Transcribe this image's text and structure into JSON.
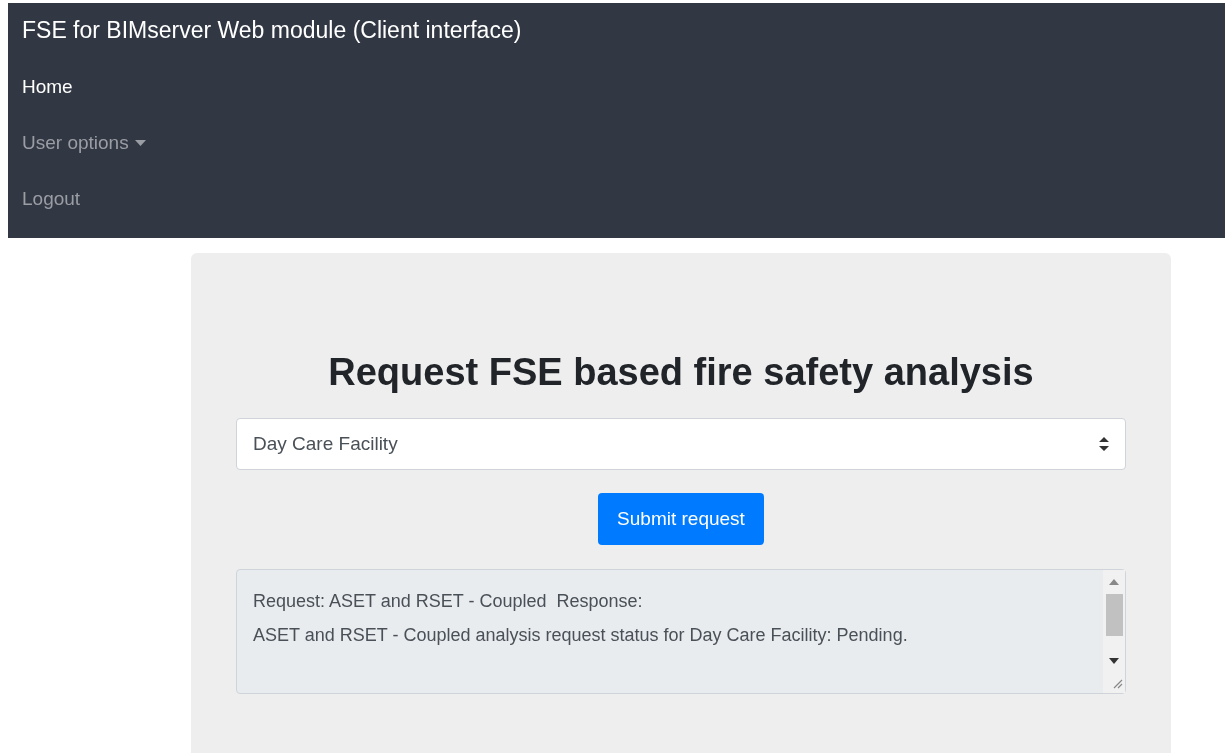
{
  "navbar": {
    "brand": "FSE for BIMserver Web module (Client interface)",
    "items": [
      {
        "label": "Home",
        "selected": true,
        "dropdown": false
      },
      {
        "label": "User options",
        "selected": false,
        "dropdown": true
      },
      {
        "label": "Logout",
        "selected": false,
        "dropdown": false
      }
    ]
  },
  "panel": {
    "heading": "Request FSE based fire safety analysis",
    "select": {
      "value": "Day Care Facility"
    },
    "submit_button": "Submit request",
    "response": {
      "lines": [
        "Request: ASET and RSET - Coupled  Response:",
        "ASET and RSET - Coupled analysis request status for Day Care Facility: Pending."
      ]
    }
  }
}
